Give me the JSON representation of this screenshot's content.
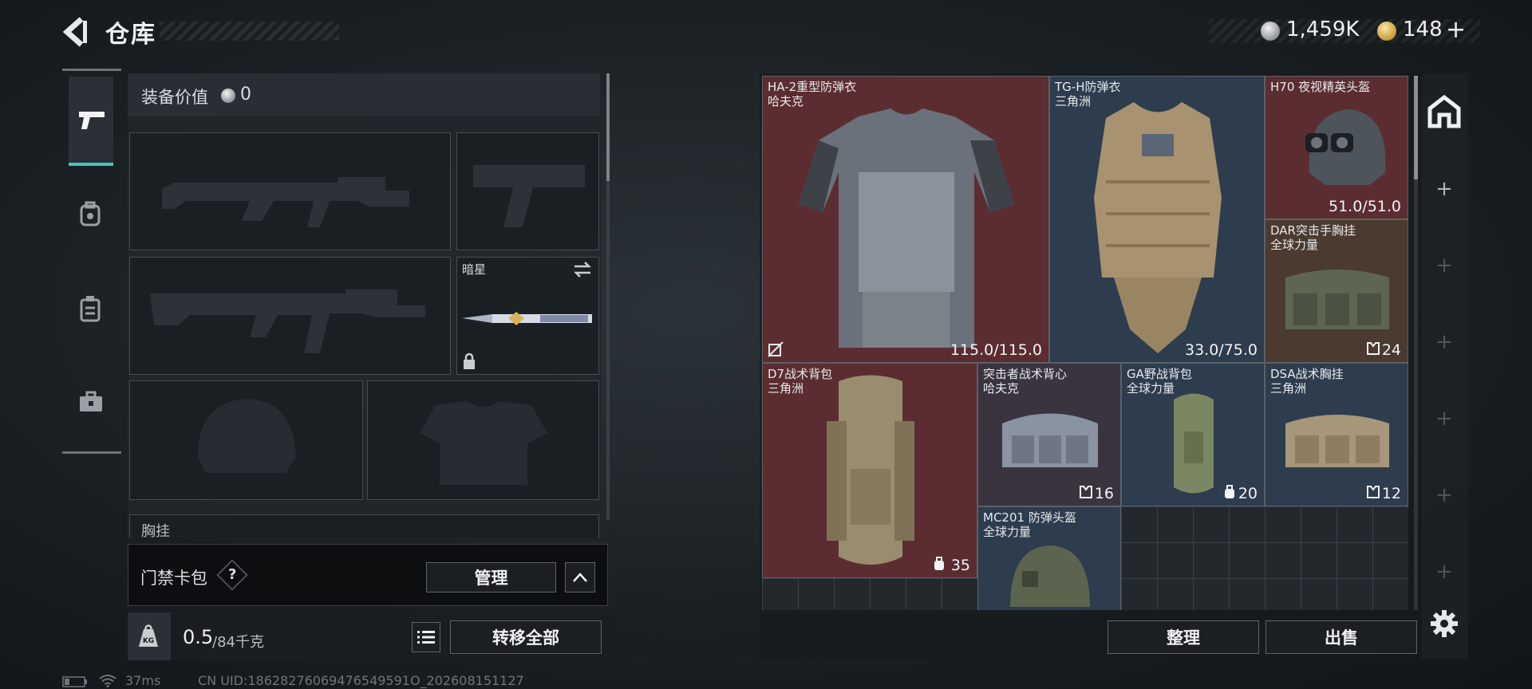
{
  "header": {
    "title": "仓库"
  },
  "currency": {
    "silver": "1,459K",
    "gold": "148",
    "gold_plus": "+"
  },
  "loadout": {
    "equip_value_label": "装备价值",
    "equip_value": "0",
    "melee_name": "暗星",
    "chest_rig_label": "胸挂"
  },
  "keycard": {
    "label": "门禁卡包",
    "help": "?",
    "manage": "管理",
    "collapse": "^"
  },
  "weight": {
    "current": "0.5",
    "capacity": "/84千克",
    "transfer_all": "转移全部"
  },
  "status": {
    "ping": "37ms",
    "uid": "CN UID:18628276069476549591O_202608151127"
  },
  "stash_items": [
    {
      "name": "HA-2重型防弹衣",
      "brand": "哈夫克",
      "value": "115.0/115.0"
    },
    {
      "name": "TG-H防弹衣",
      "brand": "三角洲",
      "value": "33.0/75.0"
    },
    {
      "name": "H70 夜视精英头盔",
      "brand": "",
      "value": "51.0/51.0"
    },
    {
      "name": "DAR突击手胸挂",
      "brand": "全球力量",
      "value": "24"
    },
    {
      "name": "D7战术背包",
      "brand": "三角洲",
      "value": "35"
    },
    {
      "name": "突击者战术背心",
      "brand": "哈夫克",
      "value": "16"
    },
    {
      "name": "GA野战背包",
      "brand": "全球力量",
      "value": "20"
    },
    {
      "name": "DSA战术胸挂",
      "brand": "三角洲",
      "value": "12"
    },
    {
      "name": "MC201 防弹头盔",
      "brand": "全球力量",
      "value": ""
    }
  ],
  "actions": {
    "organize": "整理",
    "sell": "出售"
  },
  "colors": {
    "accent": "#46c6b5",
    "rarity_red": "#5b2d31",
    "rarity_blue": "#2d3d4e",
    "rarity_brown": "#4b3a2f"
  }
}
